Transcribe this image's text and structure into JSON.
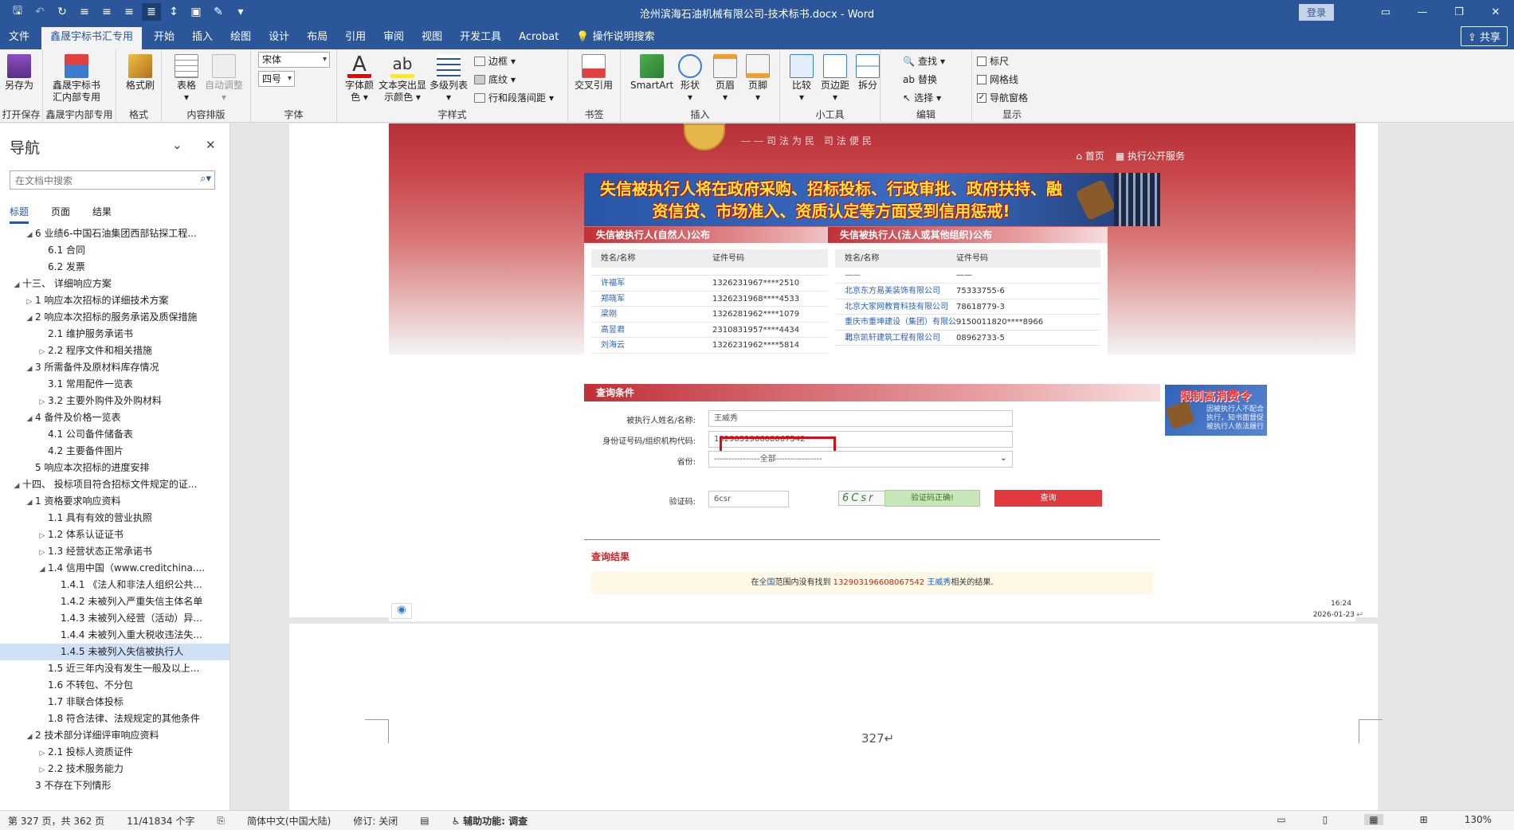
{
  "titlebar": {
    "doc_title": "沧州滨海石油机械有限公司-技术标书.docx  -  Word",
    "login": "登录",
    "win_min": "—",
    "win_restore": "❐",
    "win_close": "✕"
  },
  "menu": {
    "tabs": [
      "文件",
      "鑫晟宇标书汇专用",
      "开始",
      "插入",
      "绘图",
      "设计",
      "布局",
      "引用",
      "审阅",
      "视图",
      "开发工具",
      "Acrobat",
      "操作说明搜索"
    ],
    "share": "共享"
  },
  "ribbon": {
    "save_as": "另存为",
    "group_open_save": "打开保存",
    "xsy_btn_line1": "鑫晟宇标书",
    "xsy_btn_line2": "汇内部专用",
    "group_xsy": "鑫晟宇内部专用",
    "format_painter": "格式刷",
    "group_format": "格式",
    "table": "表格",
    "auto_adjust": "自动调整",
    "group_layout": "内容排版",
    "font_name": "宋体",
    "font_size": "四号",
    "group_font": "字体",
    "font_color_line1": "字体颜",
    "font_color_line2": "色",
    "highlight_line1": "文本突出显",
    "highlight_line2": "示颜色",
    "multilevel": "多级列表",
    "border": "边框",
    "shading": "底纹",
    "line_spacing": "行和段落间距",
    "group_para": "字样式",
    "cross_ref": "交叉引用",
    "group_bookmark": "书签",
    "smartart": "SmartArt",
    "shape": "形状",
    "header": "页眉",
    "footer": "页脚",
    "group_insert": "插入",
    "compare": "比较",
    "margins": "页边距",
    "split": "拆分",
    "group_tools": "小工具",
    "find": "查找",
    "replace": "替换",
    "select": "选择",
    "group_edit": "编辑",
    "ruler": "标尺",
    "gridlines": "网格线",
    "nav_pane": "导航窗格",
    "group_show": "显示"
  },
  "nav": {
    "title": "导航",
    "search_placeholder": "在文档中搜索",
    "tabs": [
      "标题",
      "页面",
      "结果"
    ],
    "items": [
      {
        "text": "6 业绩6-中国石油集团西部钻探工程...",
        "level": 1,
        "arrow": "▲"
      },
      {
        "text": "6.1 合同",
        "level": 2,
        "arrow": ""
      },
      {
        "text": "6.2 发票",
        "level": 2,
        "arrow": ""
      },
      {
        "text": "十三、 详细响应方案",
        "level": 0,
        "arrow": "▲"
      },
      {
        "text": "1 响应本次招标的详细技术方案",
        "level": 1,
        "arrow": "▷"
      },
      {
        "text": "2 响应本次招标的服务承诺及质保措施",
        "level": 1,
        "arrow": "▲"
      },
      {
        "text": "2.1 维护服务承诺书",
        "level": 2,
        "arrow": ""
      },
      {
        "text": "2.2 程序文件和相关措施",
        "level": 2,
        "arrow": "▷"
      },
      {
        "text": "3 所需备件及原材料库存情况",
        "level": 1,
        "arrow": "▲"
      },
      {
        "text": "3.1 常用配件一览表",
        "level": 2,
        "arrow": ""
      },
      {
        "text": "3.2 主要外购件及外购材料",
        "level": 2,
        "arrow": "▷"
      },
      {
        "text": "4 备件及价格一览表",
        "level": 1,
        "arrow": "▲"
      },
      {
        "text": "4.1 公司备件储备表",
        "level": 2,
        "arrow": ""
      },
      {
        "text": "4.2 主要备件图片",
        "level": 2,
        "arrow": ""
      },
      {
        "text": "5 响应本次招标的进度安排",
        "level": 1,
        "arrow": ""
      },
      {
        "text": "十四、 投标项目符合招标文件规定的证...",
        "level": 0,
        "arrow": "▲"
      },
      {
        "text": "1 资格要求响应资料",
        "level": 1,
        "arrow": "▲"
      },
      {
        "text": "1.1 具有有效的营业执照",
        "level": 2,
        "arrow": ""
      },
      {
        "text": "1.2 体系认证证书",
        "level": 2,
        "arrow": "▷"
      },
      {
        "text": "1.3 经营状态正常承诺书",
        "level": 2,
        "arrow": "▷"
      },
      {
        "text": "1.4 信用中国（www.creditchina....",
        "level": 2,
        "arrow": "▲"
      },
      {
        "text": "1.4.1 《法人和非法人组织公共...",
        "level": 3,
        "arrow": ""
      },
      {
        "text": "1.4.2 未被列入严重失信主体名单",
        "level": 3,
        "arrow": ""
      },
      {
        "text": "1.4.3 未被列入经营（活动）异...",
        "level": 3,
        "arrow": ""
      },
      {
        "text": "1.4.4 未被列入重大税收违法失...",
        "level": 3,
        "arrow": ""
      },
      {
        "text": "1.4.5 未被列入失信被执行人",
        "level": 3,
        "arrow": "",
        "selected": true
      },
      {
        "text": "1.5 近三年内没有发生一般及以上...",
        "level": 2,
        "arrow": ""
      },
      {
        "text": "1.6 不转包、不分包",
        "level": 2,
        "arrow": ""
      },
      {
        "text": "1.7 非联合体投标",
        "level": 2,
        "arrow": ""
      },
      {
        "text": "1.8 符合法律、法规规定的其他条件",
        "level": 2,
        "arrow": ""
      },
      {
        "text": "2 技术部分详细评审响应资料",
        "level": 1,
        "arrow": "▲"
      },
      {
        "text": "2.1 投标人资质证件",
        "level": 2,
        "arrow": "▷"
      },
      {
        "text": "2.2 技术服务能力",
        "level": 2,
        "arrow": "▷"
      },
      {
        "text": "3 不存在下列情形",
        "level": 1,
        "arrow": ""
      }
    ]
  },
  "website": {
    "slogan": "——司法为民  司法便民",
    "home": "⌂ 首页",
    "exec": "▦ 执行公开服务",
    "banner_line1": "失信被执行人将在政府采购、招标投标、行政审批、政府扶持、融",
    "banner_line2": "资信贷、市场准入、资质认定等方面受到信用惩戒!",
    "panel1": {
      "title": "失信被执行人(自然人)公布",
      "col1": "姓名/名称",
      "col2": "证件号码",
      "rows": [
        {
          "name": "许福军",
          "id": "1326231967****2510"
        },
        {
          "name": "郑晓军",
          "id": "1326231968****4533"
        },
        {
          "name": "梁刚",
          "id": "1326281962****1079"
        },
        {
          "name": "高昱君",
          "id": "2310831957****4434"
        },
        {
          "name": "刘海云",
          "id": "1326231962****5814"
        }
      ]
    },
    "panel2": {
      "title": "失信被执行人(法人或其他组织)公布",
      "col1": "姓名/名称",
      "col2": "证件号码",
      "rows": [
        {
          "name": "北京东方易美装饰有限公司",
          "id": "75333755-6"
        },
        {
          "name": "北京大家网教育科技有限公司",
          "id": "78618779-3"
        },
        {
          "name": "重庆市重坤建设（集团）有限公司",
          "id": "9150011820****8966"
        },
        {
          "name": "北京凯轩建筑工程有限公司",
          "id": "08962733-5"
        }
      ]
    },
    "query": {
      "title": "查询条件",
      "name_label": "被执行人姓名/名称:",
      "name_value": "王威秀",
      "id_label": "身份证号码/组织机构代码:",
      "id_value": "132903196608067542",
      "province_label": "省份:",
      "province_value": "----------------全部----------------",
      "captcha_label": "验证码:",
      "captcha_value": "6csr",
      "captcha_img": "6Csr",
      "captcha_ok": "验证码正确!",
      "query_btn": "查询"
    },
    "ad_title": "限制高消费令",
    "ad_sub": "因被执行人不配合执行，知书面督促被执行人依法履行",
    "result": {
      "title": "查询结果",
      "prefix": "在",
      "scope": "全国",
      "mid": "范围内没有找到",
      "id": "132903196608067542",
      "name": "王威秀",
      "suffix": "相关的结果."
    },
    "stamp_time": "16:24",
    "stamp_date": "2026-01-23"
  },
  "page_number": "327↵",
  "status": {
    "page": "第 327 页，共 362 页",
    "words": "11/41834 个字",
    "lang": "简体中文(中国大陆)",
    "track": "修订: 关闭",
    "access": "辅助功能: 调查",
    "zoom": "130%"
  }
}
